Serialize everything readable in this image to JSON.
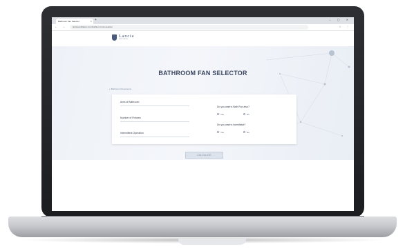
{
  "browser": {
    "tab_title": "Bathroom Fan Selector",
    "new_tab": "+",
    "window_controls": "– ▢ ✕",
    "nav": "← → ⟳",
    "url": "lanciaventilation.com/bathroom-fan-selector",
    "toolbar_icons": "☆ ⋮"
  },
  "site": {
    "logo_text": "Lancia",
    "logo_sub": "VENTILATION"
  },
  "page": {
    "title": "BATHROOM FAN SELECTOR",
    "section_label": "+ Bathroom Dimensions",
    "fields": [
      {
        "label": "Area of Bathroom"
      },
      {
        "label": "Number of Fixtures"
      },
      {
        "label": "Intermittent Operation"
      }
    ],
    "questions": [
      {
        "label": "Do you want a Bath Fan also?",
        "options": [
          "Yes",
          "No"
        ]
      },
      {
        "label": "Do you want a humidistat?",
        "options": [
          "Yes",
          "No"
        ]
      }
    ],
    "button_label": "CALCULATE"
  },
  "colors": {
    "accent": "#3a4560",
    "hero_bg": "#eef2f8"
  }
}
